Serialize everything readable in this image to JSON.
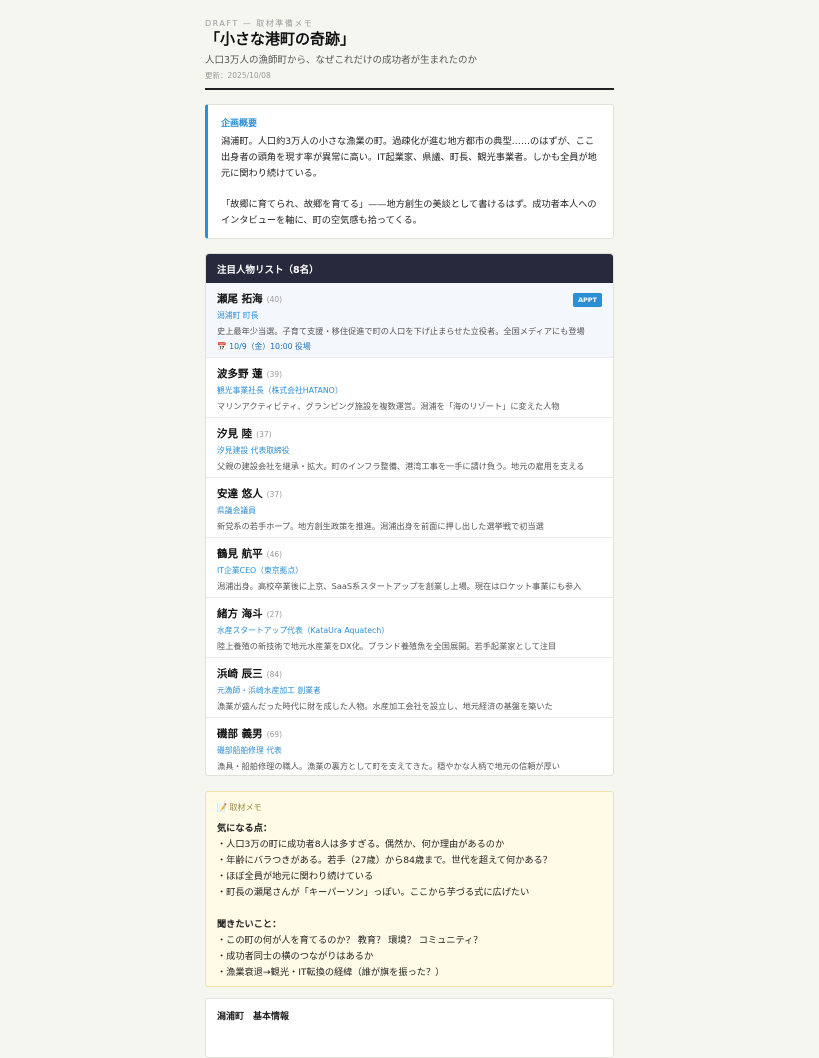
{
  "header": {
    "draft": "DRAFT — 取材準備メモ",
    "title": "「小さな港町の奇跡」",
    "subtitle": "人口3万人の漁師町から、なぜこれだけの成功者が生まれたのか",
    "updated": "更新：2025/10/08"
  },
  "overview": {
    "label": "企画概要",
    "p1": "潟浦町。人口約3万人の小さな漁業の町。過疎化が進む地方都市の典型……のはずが、ここ出身者の頭角を現す率が異常に高い。IT起業家、県議、町長、観光事業者。しかも全員が地元に関わり続けている。",
    "p2": "「故郷に育てられ、故郷を育てる」——地方創生の美談として書けるはず。成功者本人へのインタビューを軸に、町の空気感も拾ってくる。"
  },
  "people": {
    "header": "注目人物リスト（8名）",
    "badge": "APPT",
    "items": [
      {
        "name": "瀬尾 拓海",
        "age": "(40)",
        "role": "潟浦町 町長",
        "desc": "史上最年少当選。子育て支援・移住促進で町の人口を下げ止まらせた立役者。全国メディアにも登場",
        "appt": "📅 10/9（金）10:00 役場"
      },
      {
        "name": "波多野 蓮",
        "age": "(39)",
        "role": "観光事業社長（株式会社HATANO）",
        "desc": "マリンアクティビティ、グランピング施設を複数運営。潟浦を「海のリゾート」に変えた人物"
      },
      {
        "name": "汐見 陸",
        "age": "(37)",
        "role": "汐見建設 代表取締役",
        "desc": "父親の建設会社を継承・拡大。町のインフラ整備、港湾工事を一手に請け負う。地元の雇用を支える"
      },
      {
        "name": "安達 悠人",
        "age": "(37)",
        "role": "県議会議員",
        "desc": "新党系の若手ホープ。地方創生政策を推進。潟浦出身を前面に押し出した選挙戦で初当選"
      },
      {
        "name": "鶴見 航平",
        "age": "(46)",
        "role": "IT企業CEO（東京拠点）",
        "desc": "潟浦出身。高校卒業後に上京、SaaS系スタートアップを創業し上場。現在はロケット事業にも参入"
      },
      {
        "name": "緒方 海斗",
        "age": "(27)",
        "role": "水産スタートアップ代表（KataUra Aquatech）",
        "desc": "陸上養殖の新技術で地元水産業をDX化。ブランド養殖魚を全国展開。若手起業家として注目"
      },
      {
        "name": "浜崎 辰三",
        "age": "(84)",
        "role": "元漁師・浜崎水産加工 創業者",
        "desc": "漁業が盛んだった時代に財を成した人物。水産加工会社を設立し、地元経済の基盤を築いた"
      },
      {
        "name": "磯部 義男",
        "age": "(69)",
        "role": "磯部船舶修理 代表",
        "desc": "漁具・船舶修理の職人。漁業の裏方として町を支えてきた。穏やかな人柄で地元の信頼が厚い"
      }
    ]
  },
  "memo": {
    "label": "📝 取材メモ",
    "h1": "気になる点：",
    "points1": [
      "・人口3万の町に成功者8人は多すぎる。偶然か、何か理由があるのか",
      "・年齢にバラつきがある。若手（27歳）から84歳まで。世代を超えて何かある？",
      "・ほぼ全員が地元に関わり続けている",
      "・町長の瀬尾さんが「キーパーソン」っぽい。ここから芋づる式に広げたい"
    ],
    "h2": "聞きたいこと：",
    "points2": [
      "・この町の何が人を育てるのか？ 教育？ 環境？ コミュニティ？",
      "・成功者同士の横のつながりはあるか",
      "・漁業衰退→観光・IT転換の経緯（誰が旗を振った？）"
    ]
  },
  "basic": {
    "title": "潟浦町　基本情報"
  }
}
